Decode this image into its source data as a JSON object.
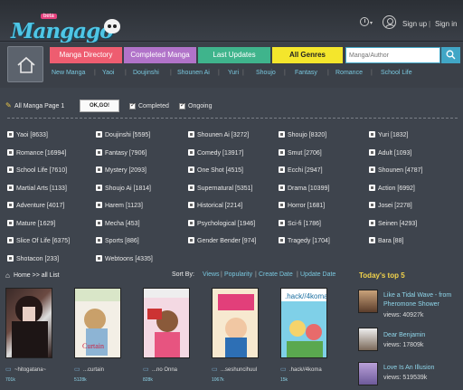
{
  "header": {
    "logo_text": "Mangago",
    "beta_badge": "beta",
    "signup": "Sign up",
    "separator": "|",
    "signin": "Sign in"
  },
  "nav": {
    "buttons": [
      "Manga Directory",
      "Completed Manga",
      "Last Updates",
      "All Genres"
    ],
    "search_placeholder": "Manga/Author",
    "links": [
      "New Manga",
      "Yaoi",
      "Doujinshi",
      "Shounen Ai",
      "Yuri",
      "Shoujo",
      "Fantasy",
      "Romance",
      "School Life"
    ]
  },
  "filter": {
    "label": "All Manga Page 1",
    "button": "OK,GO!",
    "completed": "Completed",
    "ongoing": "Ongoing"
  },
  "genres": [
    [
      "Yaoi [8633]",
      "Doujinshi [5595]",
      "Shounen Ai [3272]",
      "Shoujo [8320]",
      "Yuri [1832]"
    ],
    [
      "Romance [16994]",
      "Fantasy [7906]",
      "Comedy [13917]",
      "Smut [2706]",
      "Adult [1093]"
    ],
    [
      "School Life [7610]",
      "Mystery [2093]",
      "One Shot [4515]",
      "Ecchi [2947]",
      "Shounen [4787]"
    ],
    [
      "Martial Arts [1133]",
      "Shoujo Ai [1814]",
      "Supernatural [5351]",
      "Drama [10399]",
      "Action [6992]"
    ],
    [
      "Adventure [4017]",
      "Harem [1123]",
      "Historical [2214]",
      "Horror [1681]",
      "Josei [2278]"
    ],
    [
      "Mature [1629]",
      "Mecha [453]",
      "Psychological [1946]",
      "Sci-fi [1786]",
      "Seinen [4293]"
    ],
    [
      "Slice Of Life [6375]",
      "Sports [886]",
      "Gender Bender [974]",
      "Tragedy [1704]",
      "Bara [88]"
    ],
    [
      "Shotacon [233]",
      "Webtoons [4335]"
    ]
  ],
  "list": {
    "breadcrumb": "Home >> all List",
    "sort_label": "Sort By:",
    "sort_options": [
      "Views",
      "Popularity",
      "Create Date",
      "Update Date"
    ],
    "items": [
      {
        "title": "~hitogatana~",
        "views": "701k"
      },
      {
        "title": "...curtain",
        "views": "5128k"
      },
      {
        "title": "...no Onna",
        "views": "828k"
      },
      {
        "title": "...seshuncihuul",
        "views": "1067k"
      },
      {
        "title": ".hack//4koma",
        "views": "15k"
      }
    ]
  },
  "top5": {
    "title": "Today's top 5",
    "items": [
      {
        "name": "Like a Tidal Wave - from Pheromone Shower",
        "views": "views: 40927k"
      },
      {
        "name": "Dear Benjamin",
        "views": "views: 17809k"
      },
      {
        "name": "Love Is An Illusion",
        "views": "views: 519539k"
      }
    ]
  }
}
